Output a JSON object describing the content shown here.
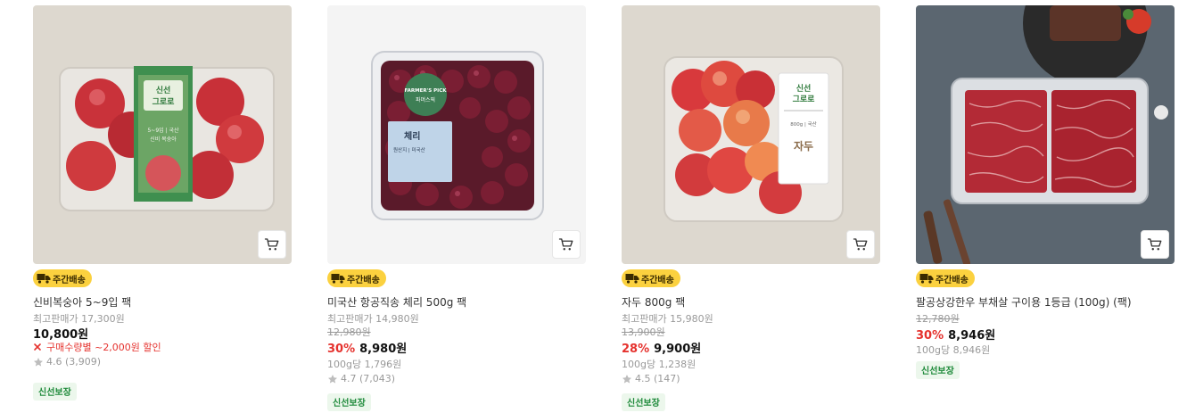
{
  "colors": {
    "delivery_badge_bg": "#fbd13f",
    "discount_red": "#e5322e",
    "fresh_badge_bg": "#ecf7ec",
    "fresh_badge_text": "#1e8a3a"
  },
  "products": [
    {
      "image_icon": "peach-pack-image",
      "package_label": {
        "line1": "신선",
        "line2": "그로로",
        "desc1": "5~9입 | 국산",
        "desc2": "신비 복숭아"
      },
      "delivery_badge": "주간배송",
      "name": "신비복숭아 5~9입 팩",
      "max_price": "최고판매가 17,300원",
      "price": "10,800원",
      "promo": "구매수량별 ~2,000원 할인",
      "rating": "4.6 (3,909)",
      "fresh_badge": "신선보장"
    },
    {
      "image_icon": "cherry-pack-image",
      "package_label": {
        "brand": "FARMER'S PICK",
        "sub": "파머스픽",
        "title": "체리",
        "desc": "원산지 | 미국산"
      },
      "delivery_badge": "주간배송",
      "name": "미국산 항공직송 체리 500g 팩",
      "max_price": "최고판매가 14,980원",
      "original_price": "12,980원",
      "discount_rate": "30%",
      "price": "8,980원",
      "unit_price": "100g당 1,796원",
      "rating": "4.7 (7,043)",
      "fresh_badge": "신선보장"
    },
    {
      "image_icon": "plum-pack-image",
      "package_label": {
        "line1": "신선",
        "line2": "그로로",
        "desc": "800g | 국산",
        "title": "자두"
      },
      "delivery_badge": "주간배송",
      "name": "자두 800g 팩",
      "max_price": "최고판매가 15,980원",
      "original_price": "13,900원",
      "discount_rate": "28%",
      "price": "9,900원",
      "unit_price": "100g당 1,238원",
      "rating": "4.5 (147)",
      "fresh_badge": "신선보장"
    },
    {
      "image_icon": "hanwoo-beef-pack-image",
      "delivery_badge": "주간배송",
      "name": "팔공상강한우 부채살 구이용 1등급 (100g) (팩)",
      "original_price": "12,780원",
      "discount_rate": "30%",
      "price": "8,946원",
      "unit_price": "100g당 8,946원",
      "fresh_badge": "신선보장"
    }
  ]
}
